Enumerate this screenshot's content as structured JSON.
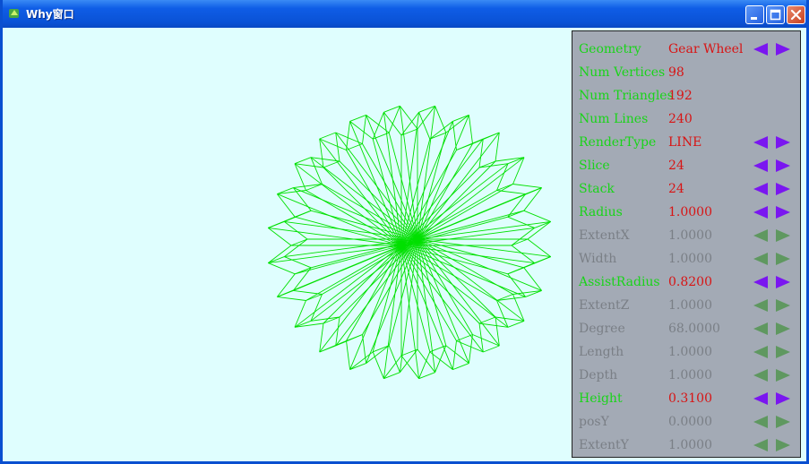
{
  "window": {
    "title": "Why窗口"
  },
  "panel": {
    "rows": [
      {
        "label": "Geometry",
        "value": "Gear Wheel",
        "enabled": true,
        "arrows": true
      },
      {
        "label": "Num Vertices",
        "value": "98",
        "enabled": true,
        "arrows": false
      },
      {
        "label": "Num Triangles",
        "value": "192",
        "enabled": true,
        "arrows": false
      },
      {
        "label": "Num Lines",
        "value": "240",
        "enabled": true,
        "arrows": false
      },
      {
        "label": "RenderType",
        "value": "LINE",
        "enabled": true,
        "arrows": true
      },
      {
        "label": "Slice",
        "value": "24",
        "enabled": true,
        "arrows": true
      },
      {
        "label": "Stack",
        "value": "24",
        "enabled": true,
        "arrows": true
      },
      {
        "label": "Radius",
        "value": "1.0000",
        "enabled": true,
        "arrows": true
      },
      {
        "label": "ExtentX",
        "value": "1.0000",
        "enabled": false,
        "arrows": true
      },
      {
        "label": "Width",
        "value": "1.0000",
        "enabled": false,
        "arrows": true
      },
      {
        "label": "AssistRadius",
        "value": "0.8200",
        "enabled": true,
        "arrows": true
      },
      {
        "label": "ExtentZ",
        "value": "1.0000",
        "enabled": false,
        "arrows": true
      },
      {
        "label": "Degree",
        "value": "68.0000",
        "enabled": false,
        "arrows": true
      },
      {
        "label": "Length",
        "value": "1.0000",
        "enabled": false,
        "arrows": true
      },
      {
        "label": "Depth",
        "value": "1.0000",
        "enabled": false,
        "arrows": true
      },
      {
        "label": "Height",
        "value": "0.3100",
        "enabled": true,
        "arrows": true
      },
      {
        "label": "posY",
        "value": "0.0000",
        "enabled": false,
        "arrows": true
      },
      {
        "label": "ExtentY",
        "value": "1.0000",
        "enabled": false,
        "arrows": true
      }
    ]
  },
  "gear": {
    "teeth": 24,
    "radius": 1.0,
    "assist_radius": 0.82,
    "height": 0.31,
    "render_type": "LINE"
  },
  "colors": {
    "wire": "#00e000",
    "label_on": "#19d419",
    "value_on": "#d81414",
    "text_off": "#7a7f86",
    "arrow_on": "#7a16f0",
    "arrow_off": "#5f9860",
    "viewport_bg": "#dffefe",
    "panel_bg": "#a3aab5"
  }
}
